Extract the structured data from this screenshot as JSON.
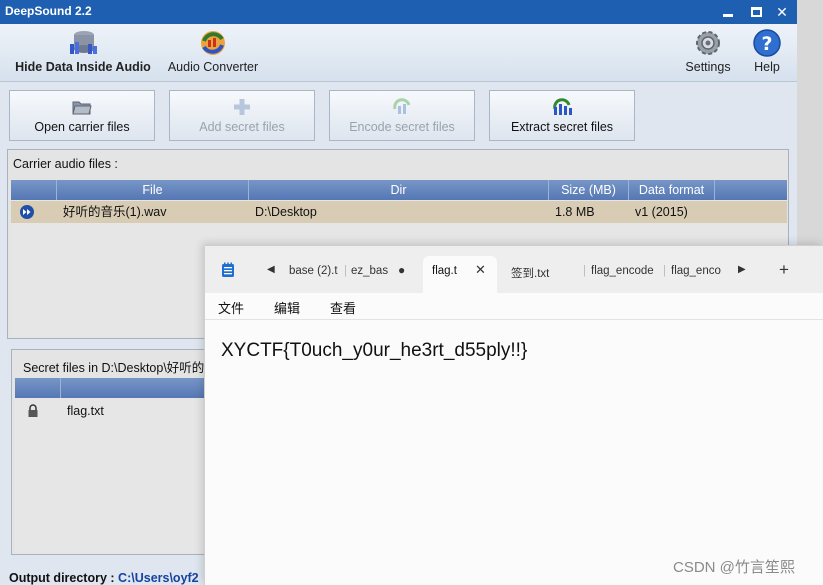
{
  "deepsound": {
    "title": "DeepSound 2.2",
    "toolbar": {
      "hide_data": "Hide Data Inside Audio",
      "audio_converter": "Audio Converter",
      "settings": "Settings",
      "help": "Help"
    },
    "actions": {
      "open_carrier": "Open carrier files",
      "add_secret": "Add secret files",
      "encode_secret": "Encode secret files",
      "extract_secret": "Extract secret files"
    },
    "carrier": {
      "label": "Carrier audio files :",
      "columns": [
        "File",
        "Dir",
        "Size (MB)",
        "Data format"
      ],
      "rows": [
        {
          "file": "好听的音乐(1).wav",
          "dir": "D:\\Desktop",
          "size": "1.8 MB",
          "format": "v1 (2015)"
        }
      ]
    },
    "secret": {
      "label": "Secret files in D:\\Desktop\\好听的",
      "rows": [
        {
          "file": "flag.txt"
        }
      ]
    },
    "output": {
      "label": "Output directory :",
      "path": "C:\\Users\\oyf2"
    }
  },
  "notepad": {
    "tabs": [
      {
        "label": "base (2).t"
      },
      {
        "label": "ez_bas"
      },
      {
        "label": "flag.t"
      },
      {
        "label": "签到.txt"
      },
      {
        "label": "flag_encode"
      },
      {
        "label": "flag_enco"
      }
    ],
    "menu": {
      "file": "文件",
      "edit": "编辑",
      "view": "查看"
    },
    "content": "XYCTF{T0uch_y0ur_he3rt_d55ply!!}",
    "new_tab": "+"
  },
  "watermark": "CSDN @竹言笙熙",
  "colors": {
    "titlebar": "#1e5fb1",
    "table_header": "#5577b4",
    "selected_row": "#d9ccb4"
  }
}
